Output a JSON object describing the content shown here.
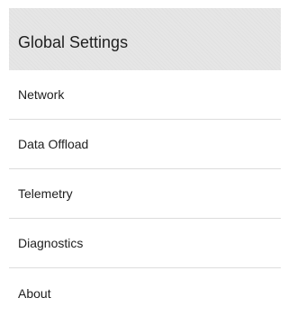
{
  "panel": {
    "title": "Global Settings",
    "items": [
      {
        "label": "Network"
      },
      {
        "label": "Data Offload"
      },
      {
        "label": "Telemetry"
      },
      {
        "label": "Diagnostics"
      },
      {
        "label": "About"
      }
    ]
  },
  "colors": {
    "header_background": "#e6e6e6",
    "divider": "#dcdcdc",
    "text": "#1e1e1e"
  }
}
